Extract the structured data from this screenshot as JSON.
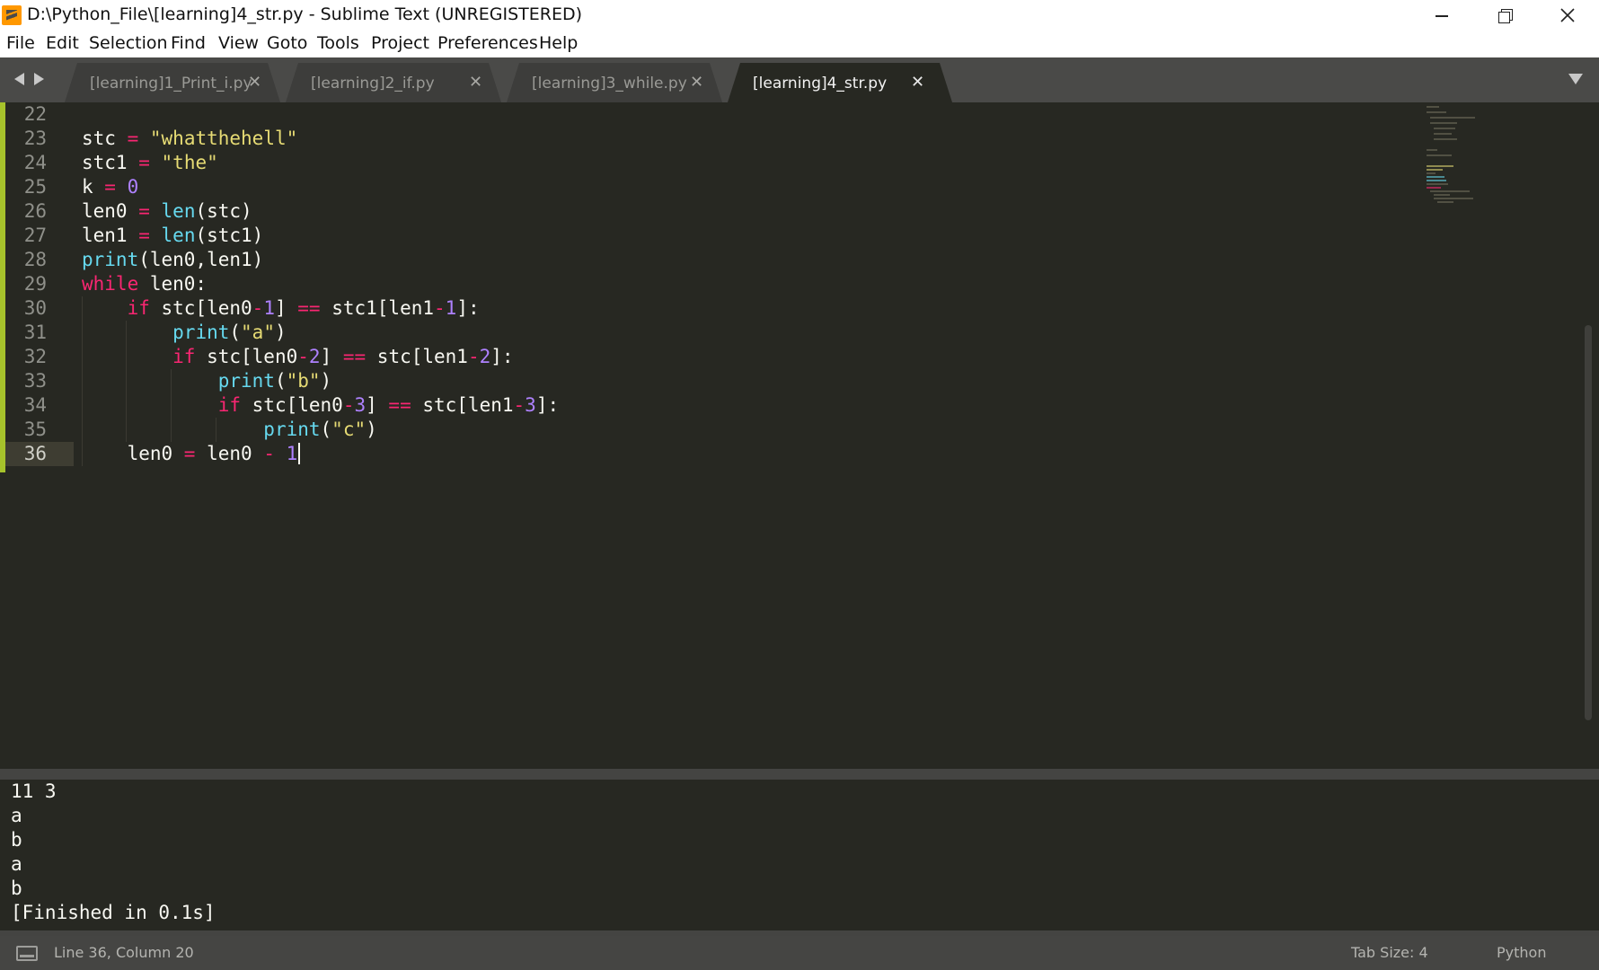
{
  "window": {
    "title": "D:\\Python_File\\[learning]4_str.py - Sublime Text (UNREGISTERED)"
  },
  "menu": [
    "File",
    "Edit",
    "Selection",
    "Find",
    "View",
    "Goto",
    "Tools",
    "Project",
    "Preferences",
    "Help"
  ],
  "tabs": [
    {
      "label": "[learning]1_Print_i.py",
      "active": false
    },
    {
      "label": "[learning]2_if.py",
      "active": false
    },
    {
      "label": "[learning]3_while.py",
      "active": false
    },
    {
      "label": "[learning]4_str.py",
      "active": true
    }
  ],
  "tab_close_glyph": "✕",
  "editor": {
    "line_numbers": [
      "22",
      "23",
      "24",
      "25",
      "26",
      "27",
      "28",
      "29",
      "30",
      "31",
      "32",
      "33",
      "34",
      "35",
      "36"
    ],
    "current_line": "36",
    "partial_line": "'''"
  },
  "output": {
    "lines": [
      "11 3",
      "a",
      "b",
      "a",
      "b",
      "[Finished in 0.1s]"
    ]
  },
  "status": {
    "position": "Line 36, Column 20",
    "tab_size": "Tab Size: 4",
    "syntax": "Python"
  },
  "colors": {
    "background": "#272822",
    "keyword": "#f92672",
    "string": "#e6db74",
    "number": "#ae81ff",
    "function": "#66d9ef",
    "git_modified": "#a6c22b"
  }
}
